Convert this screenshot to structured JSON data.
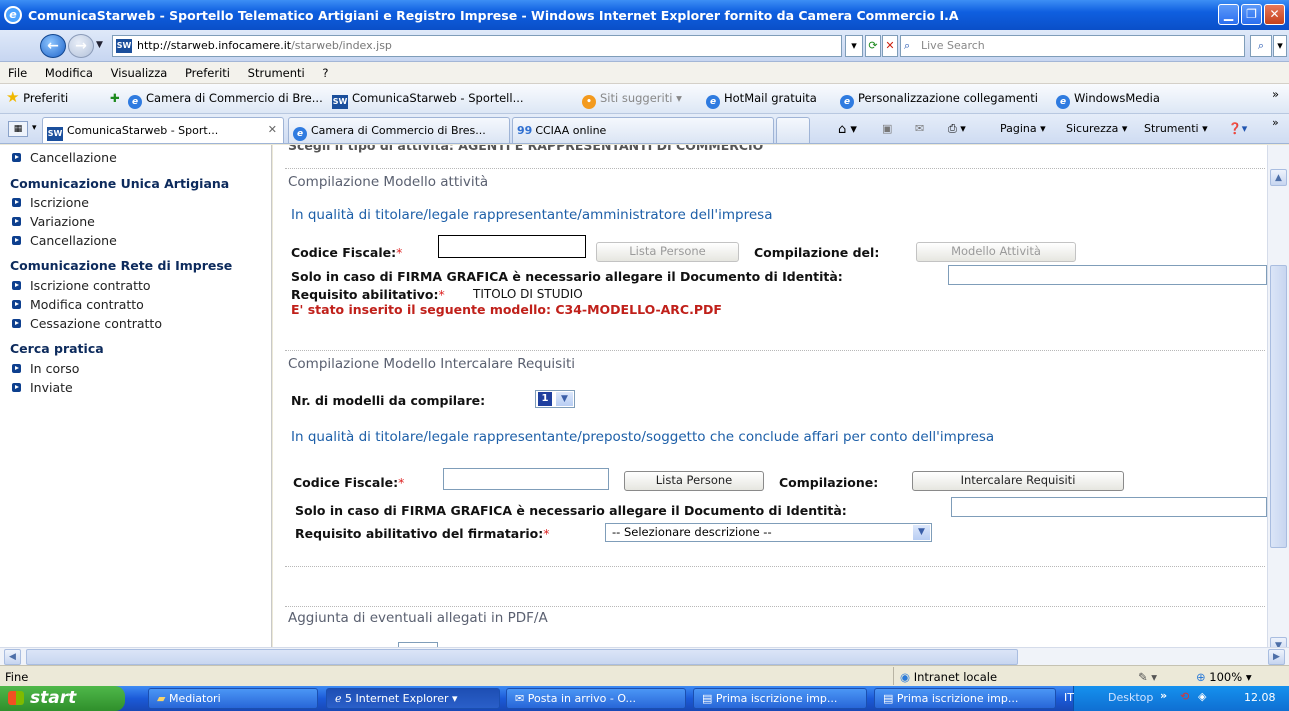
{
  "window": {
    "title": "ComunicaStarweb - Sportello Telematico Artigiani e Registro Imprese - Windows Internet Explorer fornito da Camera Commercio I.A"
  },
  "address": {
    "url_domain": "http://starweb.infocamere.it",
    "url_path": "/starweb/index.jsp",
    "search_placeholder": "Live Search"
  },
  "menu": [
    "File",
    "Modifica",
    "Visualizza",
    "Preferiti",
    "Strumenti",
    "?"
  ],
  "favorites": {
    "label": "Preferiti",
    "items": [
      "Camera di Commercio di Bre...",
      "ComunicaStarweb - Sportell...",
      "Siti suggeriti ▾",
      "HotMail gratuita",
      "Personalizzazione collegamenti",
      "WindowsMedia"
    ]
  },
  "tabs": [
    "ComunicaStarweb - Sport...",
    "Camera di Commercio di Bres...",
    "CCIAA online"
  ],
  "commandbar": {
    "page": "Pagina ▾",
    "security": "Sicurezza ▾",
    "tools": "Strumenti ▾"
  },
  "sidebar": {
    "top_item": "Cancellazione",
    "groups": [
      {
        "title": "Comunicazione Unica Artigiana",
        "items": [
          "Iscrizione",
          "Variazione",
          "Cancellazione"
        ]
      },
      {
        "title": "Comunicazione Rete di Imprese",
        "items": [
          "Iscrizione contratto",
          "Modifica contratto",
          "Cessazione contratto"
        ]
      },
      {
        "title": "Cerca pratica",
        "items": [
          "In corso",
          "Inviate"
        ]
      }
    ]
  },
  "main": {
    "cut_text": "Scegli il tipo di attività:   AGENTI E RAPPRESENTANTI DI COMMERCIO",
    "section1": {
      "title": "Compilazione Modello attività",
      "intro": "In qualità di titolare/legale rappresentante/amministratore dell'impresa",
      "codice_label": "Codice Fiscale:",
      "lista_button": "Lista Persone",
      "compilazione_label": "Compilazione del:",
      "modello_button": "Modello Attività",
      "firma_label": "Solo in caso di FIRMA GRAFICA è necessario allegare il Documento di Identità:",
      "requisito_label": "Requisito abilitativo:",
      "requisito_value": "TITOLO DI STUDIO",
      "inserted_msg": "E' stato inserito il seguente modello: C34-MODELLO-ARC.PDF"
    },
    "section2": {
      "title": "Compilazione Modello Intercalare Requisiti",
      "nr_label": "Nr. di modelli da compilare:",
      "nr_value": "1",
      "intro": "In qualità di titolare/legale rappresentante/preposto/soggetto che conclude affari per conto dell'impresa",
      "codice_label": "Codice Fiscale:",
      "lista_button": "Lista Persone",
      "compilazione_label": "Compilazione:",
      "intercalare_button": "Intercalare Requisiti",
      "firma_label": "Solo in caso di FIRMA GRAFICA è necessario allegare il Documento di Identità:",
      "requisito_label": "Requisito abilitativo del firmatario:",
      "requisito_select": "-- Selezionare descrizione --"
    },
    "section3": {
      "title": "Aggiunta di eventuali allegati in PDF/A"
    }
  },
  "status": {
    "left": "Fine",
    "zone": "Intranet locale",
    "zoom": "100%"
  },
  "taskbar": {
    "start": "start",
    "tasks": [
      "Mediatori",
      "5 Internet Explorer",
      "Posta in arrivo - O...",
      "Prima iscrizione imp...",
      "Prima iscrizione imp..."
    ],
    "lang": "IT",
    "desktop": "Desktop",
    "clock": "12.08"
  }
}
